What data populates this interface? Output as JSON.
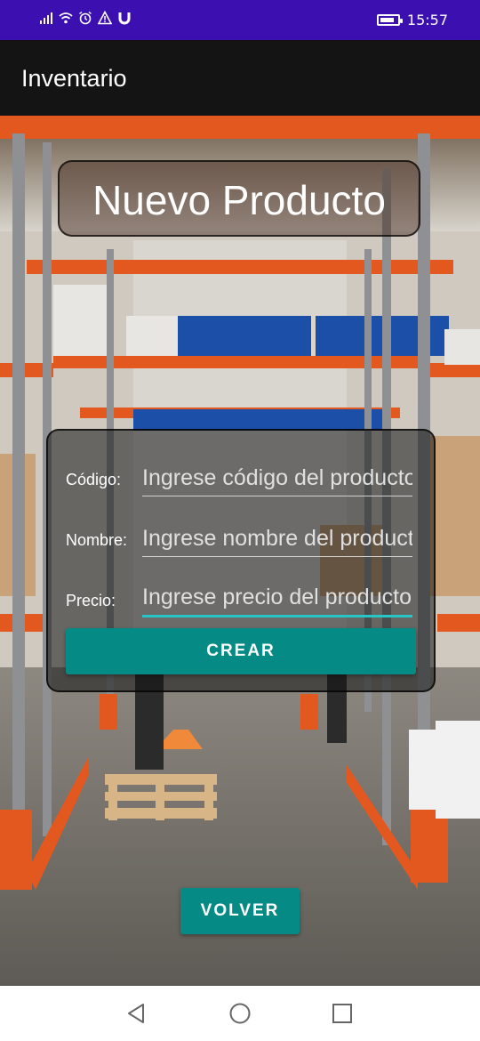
{
  "status_bar": {
    "time": "15:57",
    "left_icons": [
      "signal-icon",
      "wifi-icon",
      "alarm-icon",
      "warning-icon",
      "magnet-icon"
    ],
    "battery_level": 0.85,
    "background_color": "#3b0fb0"
  },
  "app_bar": {
    "title": "Inventario"
  },
  "page": {
    "heading": "Nuevo Producto"
  },
  "form": {
    "codigo": {
      "label": "Código:",
      "placeholder": "Ingrese código del producto"
    },
    "nombre": {
      "label": "Nombre:",
      "placeholder": "Ingrese nombre del producto"
    },
    "precio": {
      "label": "Precio:",
      "placeholder": "Ingrese precio del producto"
    },
    "create_button": "CREAR"
  },
  "back_button": "VOLVER",
  "nav_bar": {
    "buttons": [
      "back-icon",
      "home-icon",
      "recents-icon"
    ]
  },
  "colors": {
    "accent": "#068a85",
    "focus_underline": "#26c6c6"
  }
}
